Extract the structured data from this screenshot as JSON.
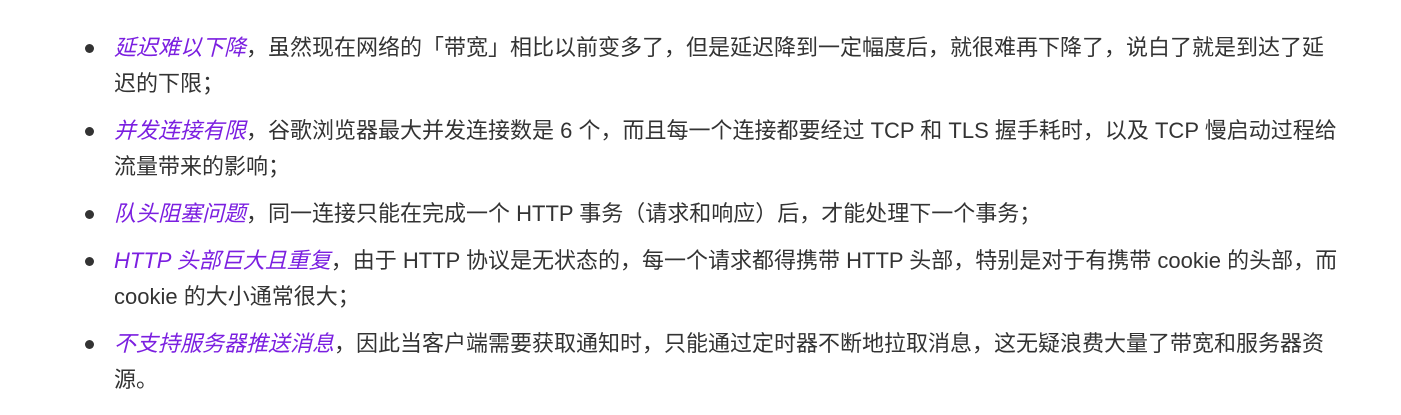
{
  "accent_color": "#7b1fe0",
  "items": [
    {
      "em": "延迟难以下降",
      "text": "，虽然现在网络的「带宽」相比以前变多了，但是延迟降到一定幅度后，就很难再下降了，说白了就是到达了延迟的下限；"
    },
    {
      "em": "并发连接有限",
      "text": "，谷歌浏览器最大并发连接数是 6 个，而且每一个连接都要经过 TCP 和 TLS 握手耗时，以及 TCP 慢启动过程给流量带来的影响；"
    },
    {
      "em": "队头阻塞问题",
      "text": "，同一连接只能在完成一个 HTTP 事务（请求和响应）后，才能处理下一个事务；"
    },
    {
      "em": "HTTP 头部巨大且重复",
      "text": "，由于 HTTP 协议是无状态的，每一个请求都得携带 HTTP 头部，特别是对于有携带 cookie 的头部，而 cookie 的大小通常很大；"
    },
    {
      "em": "不支持服务器推送消息",
      "text": "，因此当客户端需要获取通知时，只能通过定时器不断地拉取消息，这无疑浪费大量了带宽和服务器资源。"
    }
  ]
}
